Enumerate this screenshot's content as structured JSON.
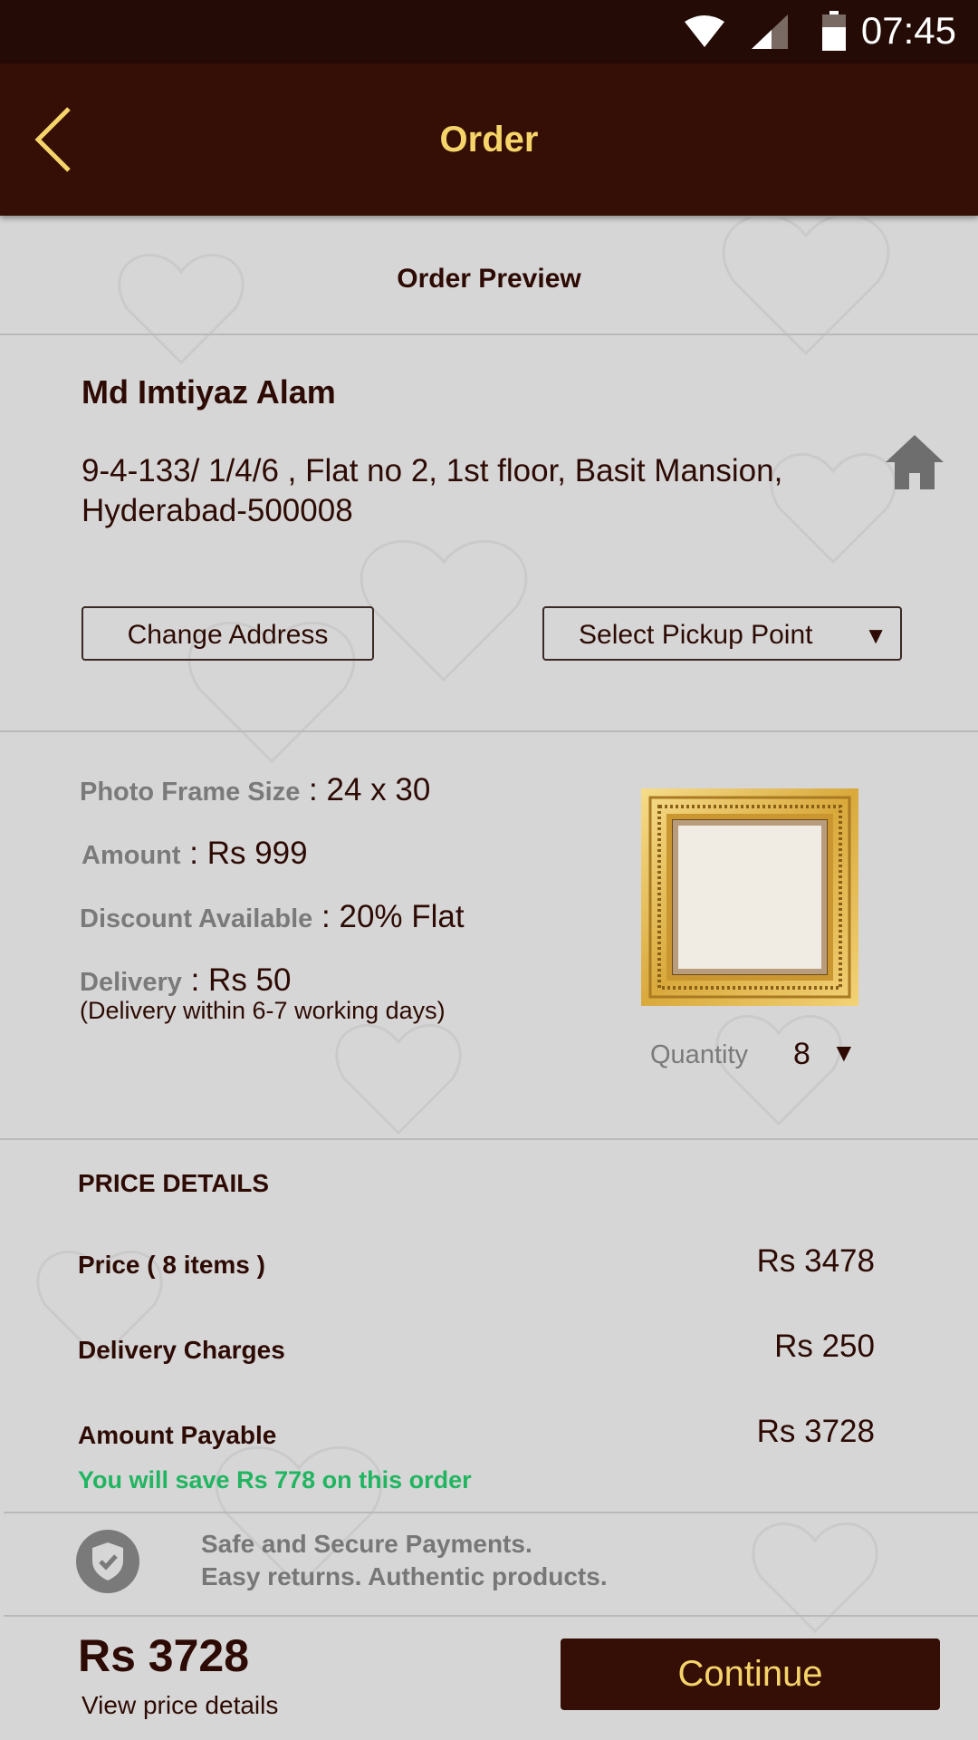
{
  "status_bar": {
    "time": "07:45"
  },
  "app_bar": {
    "title": "Order"
  },
  "order": {
    "section_title": "Order Preview"
  },
  "address": {
    "name": "Md Imtiyaz Alam",
    "line": "9-4-133/ 1/4/6 , Flat no 2, 1st floor, Basit Mansion, Hyderabad-500008",
    "change_label": "Change Address",
    "pickup_label": "Select Pickup Point"
  },
  "product": {
    "size_label": "Photo Frame Size",
    "size_value": "24 x 30",
    "amount_label": "Amount",
    "amount_value": "Rs 999",
    "discount_label": "Discount Available",
    "discount_value": "20% Flat",
    "delivery_label": "Delivery",
    "delivery_value": "Rs 50",
    "delivery_note": "(Delivery within 6-7 working days)",
    "quantity_label": "Quantity",
    "quantity_value": "8"
  },
  "price_details": {
    "heading": "PRICE DETAILS",
    "price_label": "Price ( 8 items )",
    "price_value": "Rs 3478",
    "delivery_label": "Delivery Charges",
    "delivery_value": "Rs 250",
    "payable_label": "Amount Payable",
    "payable_value": "Rs 3728",
    "save_note": "You will save Rs 778 on this order"
  },
  "secure": {
    "line1": "Safe and Secure Payments.",
    "line2": "Easy returns. Authentic products."
  },
  "footer": {
    "total": "Rs 3728",
    "view_details": "View price details",
    "continue_label": "Continue"
  },
  "colors": {
    "header": "#350e05",
    "accent": "#f5d46a",
    "save_green": "#21b561",
    "background": "#d6d6d6"
  }
}
